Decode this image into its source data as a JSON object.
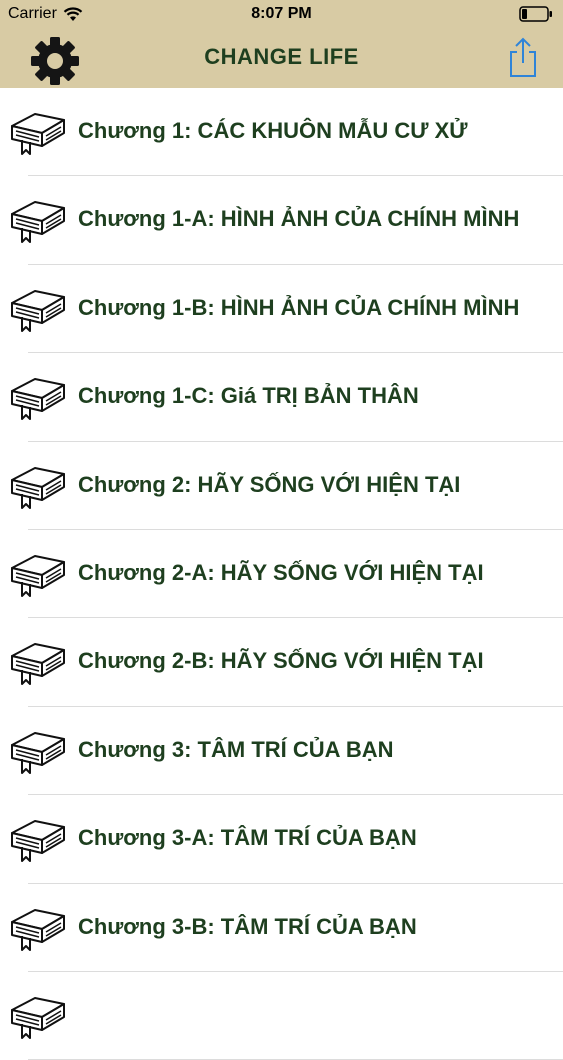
{
  "status_bar": {
    "carrier": "Carrier",
    "time": "8:07 PM"
  },
  "nav_bar": {
    "title": "CHANGE LIFE",
    "left_icon": "gear-icon",
    "right_icon": "share-icon"
  },
  "colors": {
    "nav_background": "#d8cba4",
    "title_text": "#1e3f1f",
    "row_text": "#1e3f1f",
    "share_accent": "#2f84d8",
    "separator": "#dcdcdc"
  },
  "list": {
    "row_icon": "book-icon",
    "items": [
      {
        "label": "Chương 1:  CÁC KHUÔN MẪU CƯ XỬ"
      },
      {
        "label": "Chương 1-A: HÌNH ẢNH CỦA CHÍNH MÌNH"
      },
      {
        "label": "Chương 1-B: HÌNH ẢNH CỦA CHÍNH MÌNH"
      },
      {
        "label": "Chương 1-C: Giá TRỊ BẢN THÂN"
      },
      {
        "label": "Chương 2: HÃY SỐNG VỚI HIỆN TẠI"
      },
      {
        "label": "Chương 2-A: HÃY SỐNG VỚI HIỆN TẠI"
      },
      {
        "label": "Chương 2-B: HÃY SỐNG VỚI HIỆN TẠI"
      },
      {
        "label": "Chương 3: TÂM TRÍ CỦA BẠN"
      },
      {
        "label": "Chương 3-A: TÂM TRÍ CỦA BẠN"
      },
      {
        "label": "Chương 3-B: TÂM TRÍ CỦA BẠN"
      },
      {
        "label": ""
      }
    ]
  }
}
